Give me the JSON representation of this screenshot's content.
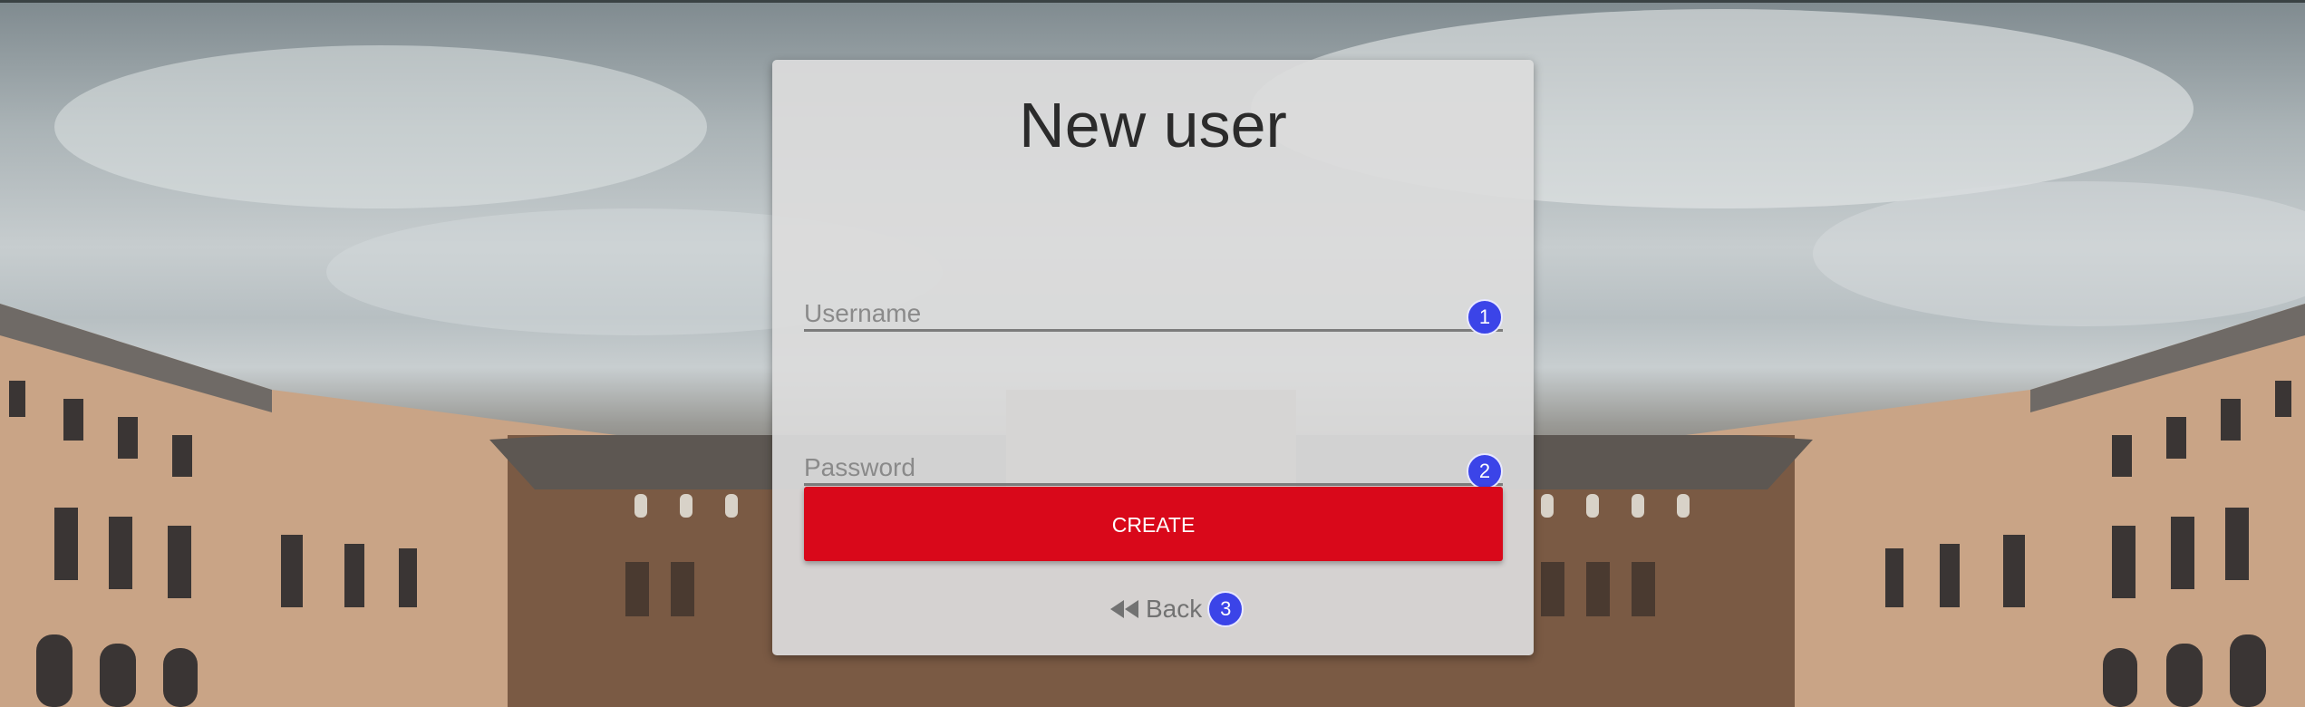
{
  "form": {
    "title": "New user",
    "username_placeholder": "Username",
    "password_placeholder": "Password",
    "create_label": "CREATE",
    "back_label": "Back"
  },
  "badges": {
    "username": "1",
    "password": "2",
    "back": "3"
  },
  "colors": {
    "accent_button": "#d9081a",
    "badge": "#3b44e8",
    "card_background": "#dcdcdc"
  },
  "icons": {
    "back": "rewind-icon"
  }
}
